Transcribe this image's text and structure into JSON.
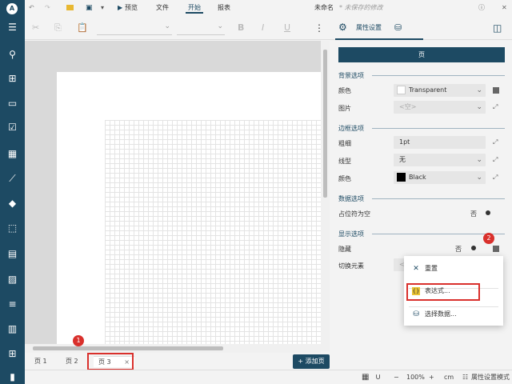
{
  "titlebar": {
    "undo_icon": "undo-icon",
    "redo_icon": "redo-icon",
    "preview_label": "预览",
    "file_label": "文件",
    "start_label": "开始",
    "report_label": "报表",
    "doc_name": "未命名",
    "unsaved_note": "* 未保存的修改"
  },
  "toolbar": {
    "props_tab_label": "属性设置"
  },
  "page_tabs": {
    "tabs": [
      "页 1",
      "页 2",
      "页 3"
    ],
    "close_glyph": "×",
    "add_page_label": "添加页"
  },
  "statusbar": {
    "zoom": "100%",
    "unit": "cm",
    "mode_label": "属性设置模式"
  },
  "panel": {
    "header": "页",
    "sections": {
      "background": "背景选项",
      "border": "边框选项",
      "data": "数据选项",
      "display": "显示选项"
    },
    "bg_color_label": "颜色",
    "bg_color_value": "Transparent",
    "bg_image_label": "图片",
    "bg_image_value": "<空>",
    "border_width_label": "粗细",
    "border_width_value": "1pt",
    "border_style_label": "线型",
    "border_style_value": "无",
    "border_color_label": "颜色",
    "border_color_value": "Black",
    "placeholder_label": "占位符为空",
    "placeholder_value": "否",
    "hidden_label": "隐藏",
    "hidden_value": "否",
    "toggle_item_label": "切换元素",
    "toggle_item_value": "<"
  },
  "context_menu": {
    "reset": "重置",
    "expression": "表达式...",
    "select_data": "选择数据..."
  },
  "callouts": [
    "1",
    "2"
  ],
  "colors": {
    "accent": "#1d4a63",
    "highlight": "#d9302c"
  }
}
